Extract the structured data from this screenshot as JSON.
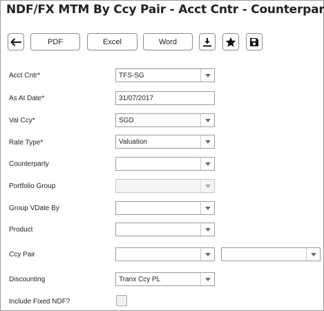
{
  "page": {
    "title": "NDF/FX MTM By Ccy Pair - Acct Cntr - Counterparty"
  },
  "toolbar": {
    "back_icon": "arrow-left-icon",
    "pdf_label": "PDF",
    "excel_label": "Excel",
    "word_label": "Word",
    "download_icon": "download-icon",
    "favorite_icon": "star-icon",
    "save_icon": "floppy-disk-icon"
  },
  "form": {
    "acct_cntr": {
      "label": "Acct Cntr*",
      "value": "TFS-SG"
    },
    "as_at_date": {
      "label": "As At Date*",
      "value": "31/07/2017"
    },
    "val_ccy": {
      "label": "Val Ccy*",
      "value": "SGD"
    },
    "rate_type": {
      "label": "Rate Type*",
      "value": "Valuation"
    },
    "counterparty": {
      "label": "Counterparty",
      "value": ""
    },
    "portfolio_group": {
      "label": "Portfolio Group",
      "value": ""
    },
    "group_vdate_by": {
      "label": "Group VDate By",
      "value": ""
    },
    "product": {
      "label": "Product",
      "value": ""
    },
    "ccy_pair": {
      "label": "Ccy Pair",
      "value_1": "",
      "value_2": ""
    },
    "discounting": {
      "label": "Discounting",
      "value": "Tranx Ccy PL"
    },
    "include_fixed_ndf": {
      "label": "Include Fixed NDF?",
      "checked": false
    }
  },
  "colors": {
    "border": "#9a9a9a",
    "caret": "#6a6a6a",
    "disabled_bg": "#f4f4f4"
  }
}
